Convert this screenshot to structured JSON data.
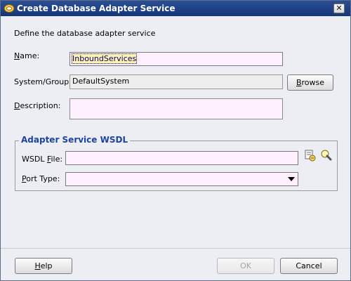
{
  "window": {
    "title": "Create Database Adapter Service",
    "close_glyph": "✕"
  },
  "intro": "Define the database adapter service",
  "name": {
    "label_pre": "",
    "label_mnemonic": "N",
    "label_post": "ame:",
    "value": "InboundServices"
  },
  "system_group": {
    "label": "System/Group:",
    "value": "DefaultSystem",
    "browse_pre": "",
    "browse_mnemonic": "B",
    "browse_post": "rowse"
  },
  "description": {
    "label_pre": "",
    "label_mnemonic": "D",
    "label_post": "escription:",
    "value": ""
  },
  "wsdl_group": {
    "title": "Adapter Service WSDL",
    "wsdl_file": {
      "label_pre": "WSDL ",
      "label_mnemonic": "F",
      "label_post": "ile:",
      "value": ""
    },
    "port_type": {
      "label_pre": "",
      "label_mnemonic": "P",
      "label_post": "ort Type:",
      "value": ""
    },
    "icons": [
      "browse-wsdl-icon",
      "flashlight-icon"
    ]
  },
  "buttons": {
    "help_pre": "",
    "help_mnemonic": "H",
    "help_post": "elp",
    "ok": "OK",
    "cancel": "Cancel"
  },
  "colors": {
    "title_bar": "#16357a",
    "group_title": "#1c44a3",
    "input_bg": "#fff0ff"
  }
}
